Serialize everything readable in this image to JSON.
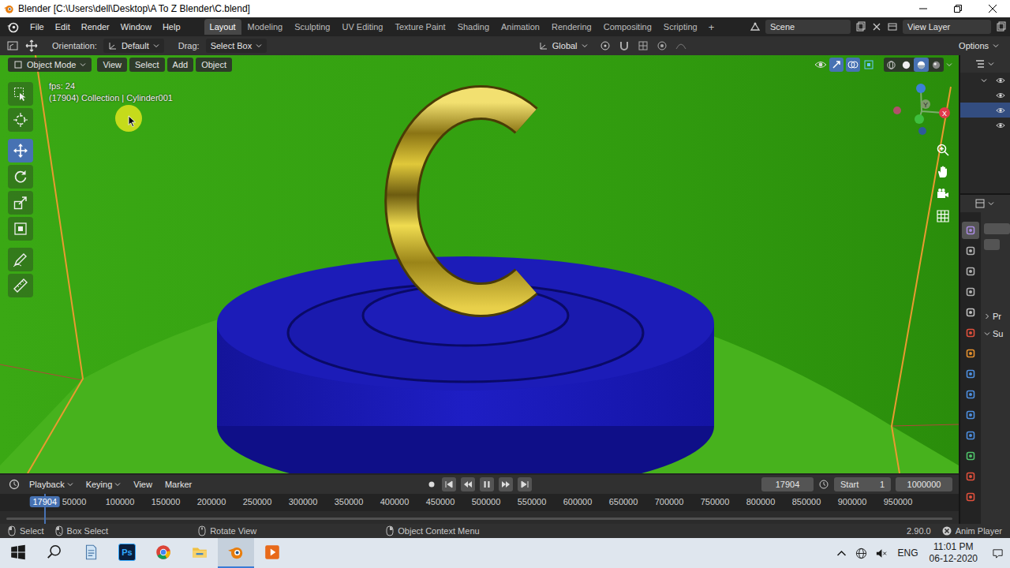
{
  "window": {
    "title": "Blender [C:\\Users\\dell\\Desktop\\A To Z Blender\\C.blend]"
  },
  "menu": [
    "File",
    "Edit",
    "Render",
    "Window",
    "Help"
  ],
  "workspaces": [
    {
      "label": "Layout",
      "selected": true
    },
    {
      "label": "Modeling",
      "selected": false
    },
    {
      "label": "Sculpting",
      "selected": false
    },
    {
      "label": "UV Editing",
      "selected": false
    },
    {
      "label": "Texture Paint",
      "selected": false
    },
    {
      "label": "Shading",
      "selected": false
    },
    {
      "label": "Animation",
      "selected": false
    },
    {
      "label": "Rendering",
      "selected": false
    },
    {
      "label": "Compositing",
      "selected": false
    },
    {
      "label": "Scripting",
      "selected": false
    }
  ],
  "add_workspace": "+",
  "scene": "Scene",
  "view_layer": "View Layer",
  "tool_header": {
    "orientation_label": "Orientation:",
    "orientation": "Default",
    "drag_label": "Drag:",
    "drag": "Select Box",
    "transform_orientation": "Global",
    "options": "Options"
  },
  "viewport": {
    "mode": "Object Mode",
    "menus": [
      "View",
      "Select",
      "Add",
      "Object"
    ],
    "fps": "fps: 24",
    "object_info": "(17904) Collection | Cylinder001",
    "shading": [
      {
        "kind": "wireframe",
        "selected": false
      },
      {
        "kind": "solid",
        "selected": false
      },
      {
        "kind": "material",
        "selected": true
      },
      {
        "kind": "rendered",
        "selected": false
      }
    ]
  },
  "toolbar": [
    {
      "kind": "select",
      "selected": false
    },
    {
      "kind": "cursor",
      "selected": false
    },
    {
      "kind": "move",
      "selected": true
    },
    {
      "kind": "rotate",
      "selected": false
    },
    {
      "kind": "scale",
      "selected": false
    },
    {
      "kind": "transform",
      "selected": false
    },
    {
      "kind": "annotate",
      "selected": false
    },
    {
      "kind": "measure",
      "selected": false
    }
  ],
  "gizmo": {
    "x": "X",
    "y": "Y"
  },
  "outliner": {
    "rows": [
      {
        "kind": "collection",
        "visible": true,
        "selected": false
      },
      {
        "kind": "object",
        "visible": true,
        "selected": false
      },
      {
        "kind": "object",
        "visible": true,
        "selected": true
      },
      {
        "kind": "object",
        "visible": true,
        "selected": false
      }
    ]
  },
  "properties": {
    "tabs": [
      {
        "color": "#a98be0",
        "selected": true
      },
      {
        "color": "#b0b0b0",
        "selected": false
      },
      {
        "color": "#b0b0b0",
        "selected": false
      },
      {
        "color": "#b0b0b0",
        "selected": false
      },
      {
        "color": "#c0c0c0",
        "selected": false
      },
      {
        "color": "#e0503c",
        "selected": false
      },
      {
        "color": "#e8922e",
        "selected": false
      },
      {
        "color": "#4e8fe0",
        "selected": false
      },
      {
        "color": "#4e8fe0",
        "selected": false
      },
      {
        "color": "#4e8fe0",
        "selected": false
      },
      {
        "color": "#4e8fe0",
        "selected": false
      },
      {
        "color": "#4fc26a",
        "selected": false
      },
      {
        "color": "#e0503c",
        "selected": false
      },
      {
        "color": "#e0503c",
        "selected": false
      }
    ],
    "panels": [
      {
        "label": "Pr",
        "expanded": false
      },
      {
        "label": "Su",
        "expanded": true
      }
    ]
  },
  "timeline": {
    "menus": [
      {
        "label": "Playback",
        "dropdown": true
      },
      {
        "label": "Keying",
        "dropdown": true
      },
      {
        "label": "View",
        "dropdown": false
      },
      {
        "label": "Marker",
        "dropdown": false
      }
    ],
    "playing": true,
    "current_frame": "17904",
    "start_label": "Start",
    "start": "1",
    "end": "1000000",
    "ruler": [
      "50000",
      "100000",
      "150000",
      "200000",
      "250000",
      "300000",
      "350000",
      "400000",
      "450000",
      "500000",
      "550000",
      "600000",
      "650000",
      "700000",
      "750000",
      "800000",
      "850000",
      "900000",
      "950000"
    ],
    "playhead": "17904"
  },
  "status_bar": {
    "items": [
      {
        "kind": "left",
        "label": "Select"
      },
      {
        "kind": "drag",
        "label": "Box Select"
      },
      {
        "kind": "middle",
        "label": "Rotate View"
      },
      {
        "kind": "right",
        "label": "Object Context Menu"
      }
    ],
    "version": "2.90.0",
    "anim_player": "Anim Player"
  },
  "taskbar": {
    "apps": [
      {
        "kind": "start",
        "label": "",
        "active": false
      },
      {
        "kind": "search",
        "label": "",
        "active": false
      },
      {
        "kind": "notes",
        "label": "",
        "active": false
      },
      {
        "kind": "photoshop",
        "label": "Ps",
        "active": false
      },
      {
        "kind": "chrome",
        "label": "",
        "active": false
      },
      {
        "kind": "explorer",
        "label": "",
        "active": false
      },
      {
        "kind": "blender",
        "label": "",
        "active": true
      },
      {
        "kind": "player",
        "label": "",
        "active": false
      }
    ],
    "language": "ENG",
    "time": "11:01 PM",
    "date": "06-12-2020"
  }
}
